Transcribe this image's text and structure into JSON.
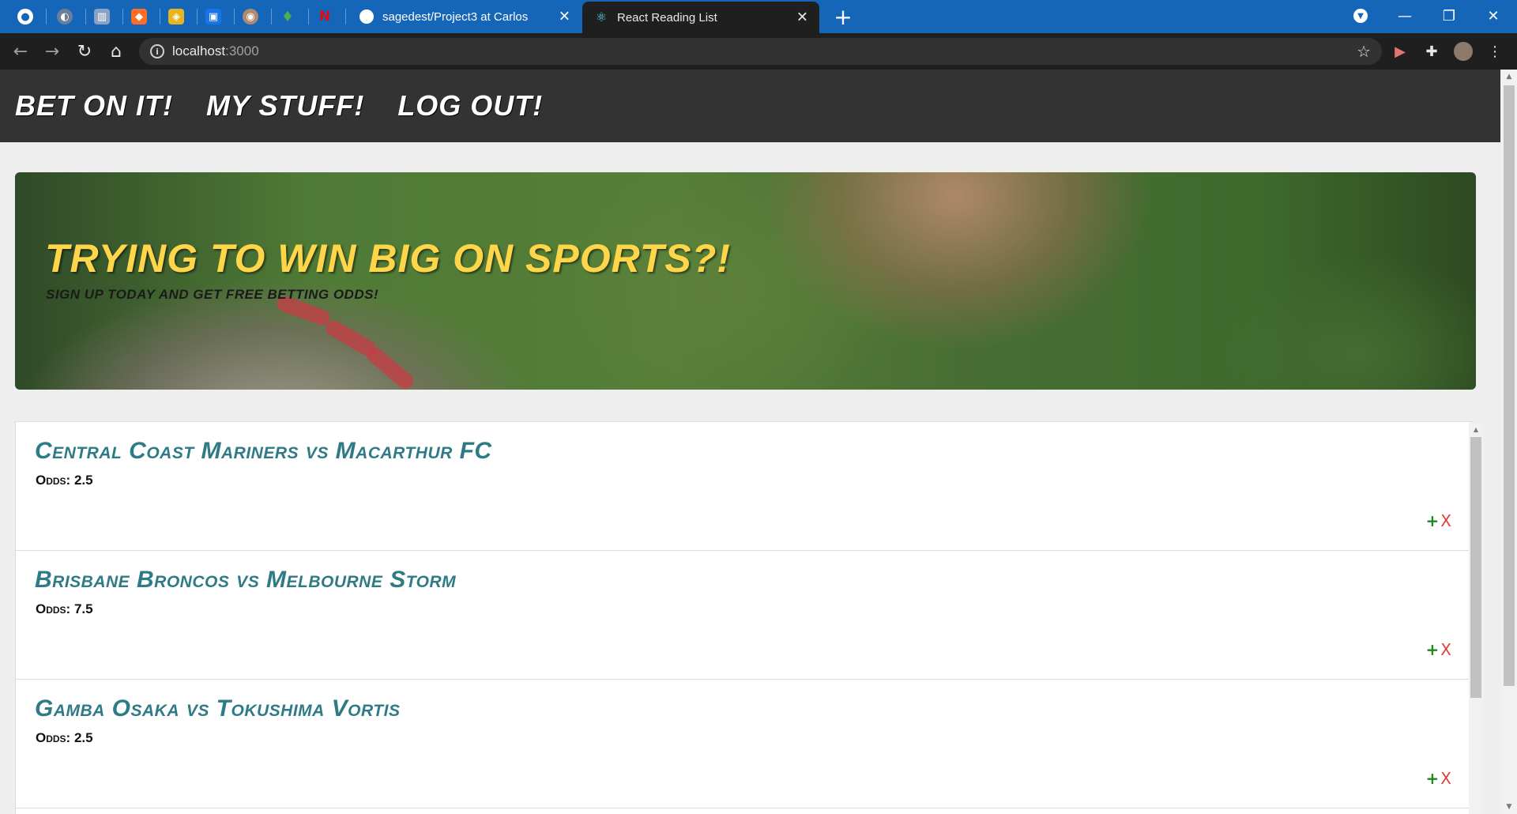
{
  "browser": {
    "pinned_tabs": [
      {
        "icon": "github-icon",
        "color": "#ffffff",
        "glyph": "●"
      },
      {
        "icon": "globe-icon",
        "color": "#6b7f99",
        "glyph": "◐"
      },
      {
        "icon": "chart-icon",
        "color": "#8aa1c4",
        "glyph": "▥"
      },
      {
        "icon": "gitlab-icon",
        "color": "#fc6d26",
        "glyph": "◆"
      },
      {
        "icon": "shield-icon",
        "color": "#e8b420",
        "glyph": "◈"
      },
      {
        "icon": "outlook-icon",
        "color": "#1a73e8",
        "glyph": "▣"
      },
      {
        "icon": "avatar-icon",
        "color": "#b08a70",
        "glyph": "◉"
      },
      {
        "icon": "leaf-icon",
        "color": "#4caf50",
        "glyph": "♦"
      },
      {
        "icon": "netflix-icon",
        "color": "#e50914",
        "glyph": "N"
      }
    ],
    "tabs": [
      {
        "title": "sagedest/Project3 at Carlos",
        "icon": "github-icon"
      },
      {
        "title": "React Reading List",
        "icon": "react-icon"
      }
    ],
    "url_host": "localhost",
    "url_port": ":3000"
  },
  "nav": {
    "links": [
      "Bet on it!",
      "My Stuff!",
      "Log out!"
    ]
  },
  "hero": {
    "title": "Trying to win big on sports?!",
    "subtitle": "Sign up today and get free betting odds!"
  },
  "games": [
    {
      "title": "Central Coast Mariners vs Macarthur FC",
      "odds_label": "Odds:",
      "odds": "2.5"
    },
    {
      "title": "Brisbane Broncos vs Melbourne Storm",
      "odds_label": "Odds:",
      "odds": "7.5"
    },
    {
      "title": "Gamba Osaka vs Tokushima Vortis",
      "odds_label": "Odds:",
      "odds": "2.5"
    }
  ],
  "actions": {
    "add": "+",
    "remove": "X"
  },
  "colors": {
    "tabstrip": "#1565b8",
    "nav_bg": "#333333",
    "hero_title": "#ffd54a",
    "game_title": "#2e7b86",
    "add": "#1b8a1b",
    "remove": "#e0403a"
  }
}
